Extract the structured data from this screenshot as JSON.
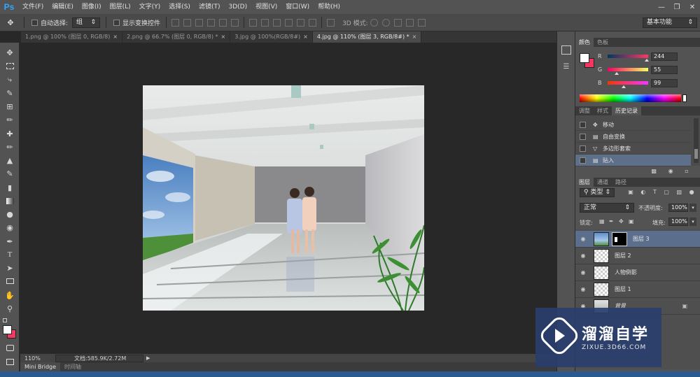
{
  "app": {
    "logo": "Ps",
    "menus": [
      "文件(F)",
      "编辑(E)",
      "图像(I)",
      "图层(L)",
      "文字(Y)",
      "选择(S)",
      "滤镜(T)",
      "3D(D)",
      "视图(V)",
      "窗口(W)",
      "帮助(H)"
    ]
  },
  "options": {
    "auto_select_label": "自动选择:",
    "auto_select_value": "组",
    "show_transform_label": "显示变换控件",
    "mode_3d_label": "3D 模式:",
    "workspace": "基本功能"
  },
  "tabs": [
    {
      "label": "1.png @ 100% (图层 0, RGB/8)",
      "active": false
    },
    {
      "label": "2.png @ 66.7% (图层 0, RGB/8) *",
      "active": false
    },
    {
      "label": "3.jpg @ 100%(RGB/8#)",
      "active": false
    },
    {
      "label": "4.jpg @ 110% (图层 3, RGB/8#) *",
      "active": true
    }
  ],
  "status": {
    "zoom": "110%",
    "doc": "文档:585.9K/2.72M"
  },
  "bottom_tabs": [
    "Mini Bridge",
    "时间轴"
  ],
  "color_panel": {
    "tabs": [
      "颜色",
      "色板"
    ],
    "r_label": "R",
    "r": "244",
    "g_label": "G",
    "g": "55",
    "b_label": "B",
    "b": "99",
    "fg_color": "#f43763",
    "r_fraction": 0.957,
    "g_fraction": 0.216,
    "b_fraction": 0.388
  },
  "history_panel": {
    "tabs": [
      "调整",
      "样式",
      "历史记录"
    ],
    "items": [
      {
        "label": "移动",
        "icon": "move-icon"
      },
      {
        "label": "自由变换",
        "icon": "document-icon"
      },
      {
        "label": "多边形套索",
        "icon": "lasso-icon"
      },
      {
        "label": "贴入",
        "icon": "document-icon",
        "active": true
      }
    ]
  },
  "layers_panel": {
    "tabs": [
      "图层",
      "通道",
      "路径"
    ],
    "filter_kind": "类型",
    "blend_mode": "正常",
    "opacity_label": "不透明度:",
    "opacity": "100%",
    "lock_label": "锁定:",
    "fill_label": "填充:",
    "fill": "100%",
    "layers": [
      {
        "name": "图层 3",
        "active": true
      },
      {
        "name": "图层 2"
      },
      {
        "name": "人物倒影"
      },
      {
        "name": "图层 1"
      },
      {
        "name": "背景"
      }
    ]
  },
  "watermark": {
    "title": "溜溜自学",
    "url": "ZIXUE.3D66.COM"
  }
}
